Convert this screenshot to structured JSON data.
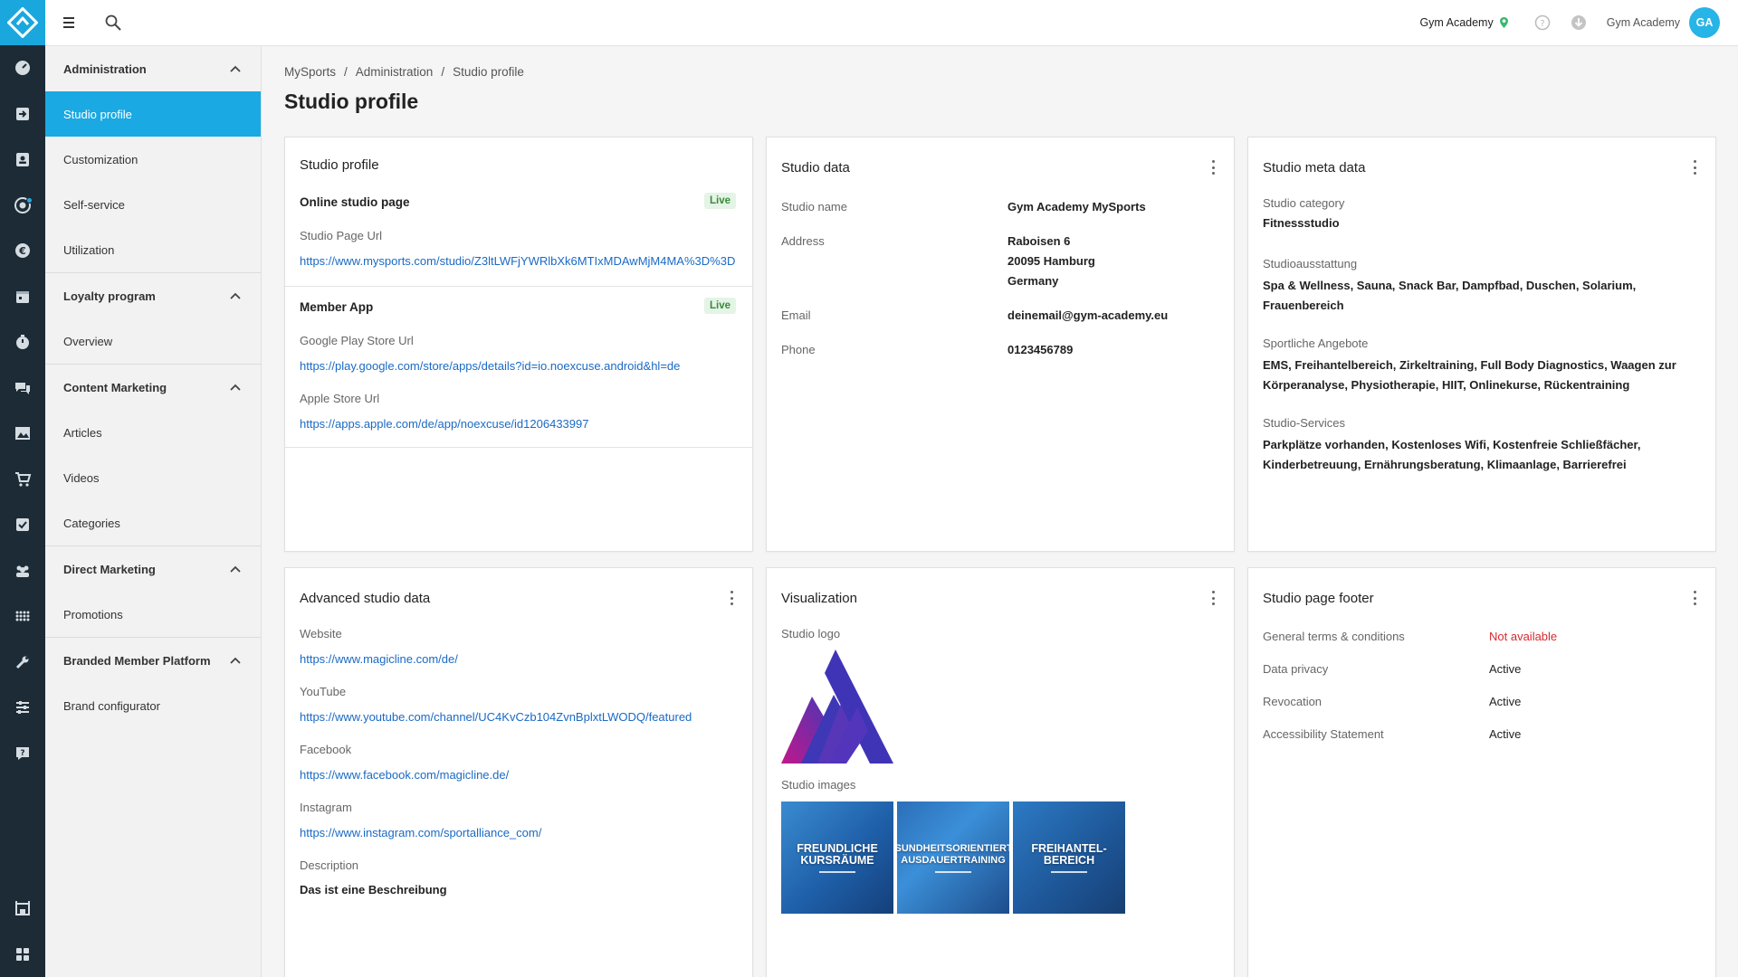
{
  "topbar": {
    "studio_name": "Gym Academy",
    "user_name": "Gym Academy",
    "avatar_initials": "GA"
  },
  "sidebar": {
    "groups": [
      {
        "title": "Administration",
        "items": [
          "Studio profile",
          "Customization",
          "Self-service",
          "Utilization"
        ]
      },
      {
        "title": "Loyalty program",
        "items": [
          "Overview"
        ]
      },
      {
        "title": "Content Marketing",
        "items": [
          "Articles",
          "Videos",
          "Categories"
        ]
      },
      {
        "title": "Direct Marketing",
        "items": [
          "Promotions"
        ]
      },
      {
        "title": "Branded Member Platform",
        "items": [
          "Brand configurator"
        ]
      }
    ],
    "active_item": "Studio profile"
  },
  "breadcrumb": [
    "MySports",
    "Administration",
    "Studio profile"
  ],
  "page_title": "Studio profile",
  "studio_profile_card": {
    "title": "Studio profile",
    "online_page": {
      "title": "Online studio page",
      "badge": "Live",
      "url_label": "Studio Page Url",
      "url": "https://www.mysports.com/studio/Z3ltLWFjYWRlbXk6MTIxMDAwMjM4MA%3D%3D"
    },
    "member_app": {
      "title": "Member App",
      "badge": "Live",
      "google_label": "Google Play Store Url",
      "google_url": "https://play.google.com/store/apps/details?id=io.noexcuse.android&hl=de",
      "apple_label": "Apple Store Url",
      "apple_url": "https://apps.apple.com/de/app/noexcuse/id1206433997"
    }
  },
  "studio_data_card": {
    "title": "Studio data",
    "name_label": "Studio name",
    "name": "Gym Academy MySports",
    "address_label": "Address",
    "address_line1": "Raboisen 6",
    "address_line2": "20095 Hamburg",
    "address_line3": "Germany",
    "email_label": "Email",
    "email": "deinemail@gym-academy.eu",
    "phone_label": "Phone",
    "phone": "0123456789"
  },
  "studio_meta_card": {
    "title": "Studio meta data",
    "category_label": "Studio category",
    "category": "Fitnessstudio",
    "equipment_label": "Studioausstattung",
    "equipment_line1": "Spa & Wellness, Sauna, Snack Bar, Dampfbad, Duschen, Solarium,",
    "equipment_line2": "Frauenbereich",
    "sports_label": "Sportliche Angebote",
    "sports_line1": "EMS, Freihantelbereich, Zirkeltraining, Full Body Diagnostics, Waagen zur",
    "sports_line2": "Körperanalyse, Physiotherapie, HIIT, Onlinekurse, Rückentraining",
    "services_label": "Studio-Services",
    "services_line1": "Parkplätze vorhanden, Kostenloses Wifi, Kostenfreie Schließfächer,",
    "services_line2": "Kinderbetreuung, Ernährungsberatung, Klimaanlage, Barrierefrei"
  },
  "advanced_card": {
    "title": "Advanced studio data",
    "website_label": "Website",
    "website": "https://www.magicline.com/de/",
    "youtube_label": "YouTube",
    "youtube": "https://www.youtube.com/channel/UC4KvCzb104ZvnBplxtLWODQ/featured",
    "facebook_label": "Facebook",
    "facebook": "https://www.facebook.com/magicline.de/",
    "instagram_label": "Instagram",
    "instagram": "https://www.instagram.com/sportalliance_com/",
    "description_label": "Description",
    "description": "Das ist eine Beschreibung"
  },
  "visualization_card": {
    "title": "Visualization",
    "logo_label": "Studio logo",
    "images_label": "Studio images",
    "images": [
      {
        "line1": "FREUNDLICHE",
        "line2": "KURSRÄUME"
      },
      {
        "line1": "GESUNDHEITSORIENTIERTES",
        "line2": "AUSDAUERTRAINING"
      },
      {
        "line1": "FREIHANTEL-",
        "line2": "BEREICH"
      }
    ]
  },
  "footer_card": {
    "title": "Studio page footer",
    "rows": [
      {
        "label": "General terms & conditions",
        "status": "Not available"
      },
      {
        "label": "Data privacy",
        "status": "Active"
      },
      {
        "label": "Revocation",
        "status": "Active"
      },
      {
        "label": "Accessibility Statement",
        "status": "Active"
      }
    ]
  },
  "colors": {
    "accent": "#1aa9e2",
    "rail": "#1c2b36",
    "link": "#1a6ac4",
    "error": "#d9292f",
    "live_bg": "#e4f4e6"
  }
}
